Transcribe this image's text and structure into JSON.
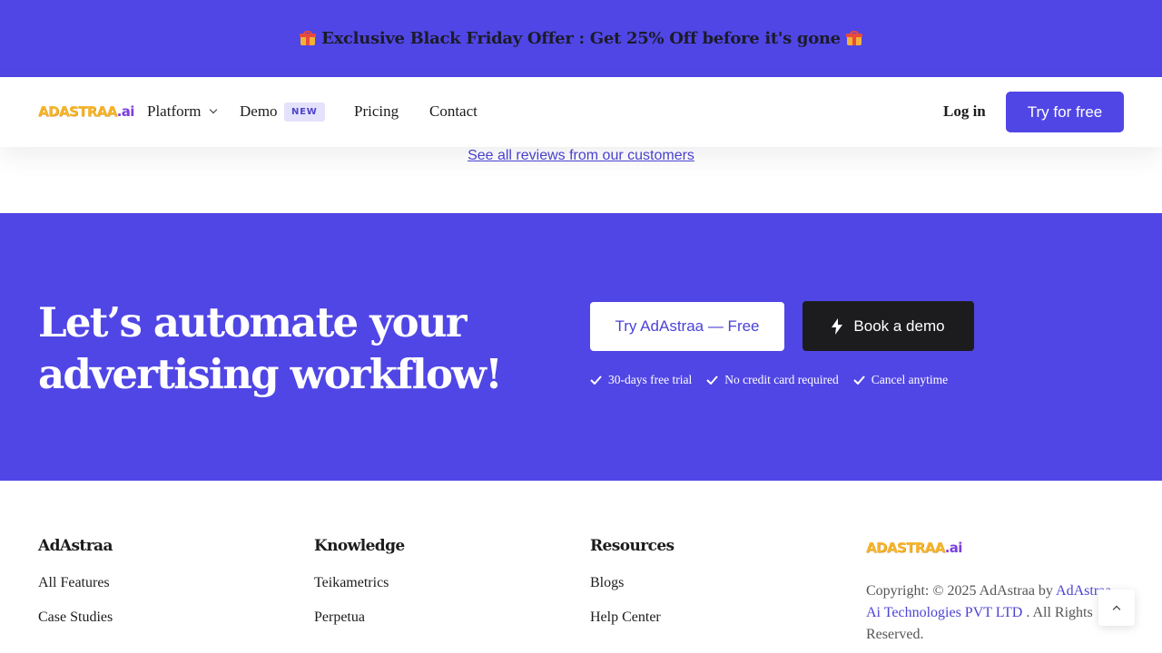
{
  "promo": {
    "text": "Exclusive Black Friday Offer : Get 25% Off before it's gone",
    "icon": "gift-icon",
    "bg_color": "#5046e5"
  },
  "nav": {
    "logo_main": "ADASTRAA",
    "logo_suffix": ".ai",
    "items": [
      {
        "label": "Platform",
        "has_dropdown": true
      },
      {
        "label": "Demo",
        "badge": "NEW"
      },
      {
        "label": "Pricing"
      },
      {
        "label": "Contact"
      }
    ],
    "login_label": "Log in",
    "cta_label": "Try for free"
  },
  "reviews": {
    "link_text": "See all reviews from our customers"
  },
  "cta": {
    "heading": "Let’s automate your advertising workflow!",
    "primary_button": "Try AdAstraa — Free",
    "secondary_button": "Book a demo",
    "perks": [
      "30-days free trial",
      "No credit card required",
      "Cancel anytime"
    ]
  },
  "footer": {
    "columns": [
      {
        "title": "AdAstraa",
        "links": [
          "All Features",
          "Case Studies"
        ]
      },
      {
        "title": "Knowledge",
        "links": [
          "Teikametrics",
          "Perpetua"
        ]
      },
      {
        "title": "Resources",
        "links": [
          "Blogs",
          "Help Center"
        ]
      }
    ],
    "logo_main": "ADASTRAA",
    "logo_suffix": ".ai",
    "copyright_prefix": "Copyright: © 2025 AdAstraa by ",
    "copyright_company": "AdAstraa Ai Technologies PVT LTD",
    "copyright_suffix": " . All Rights Reserved."
  },
  "colors": {
    "brand": "#5046e5",
    "dark": "#1c1c1e",
    "logo_yellow": "#f5b52a",
    "logo_purple": "#7c3fe0"
  }
}
